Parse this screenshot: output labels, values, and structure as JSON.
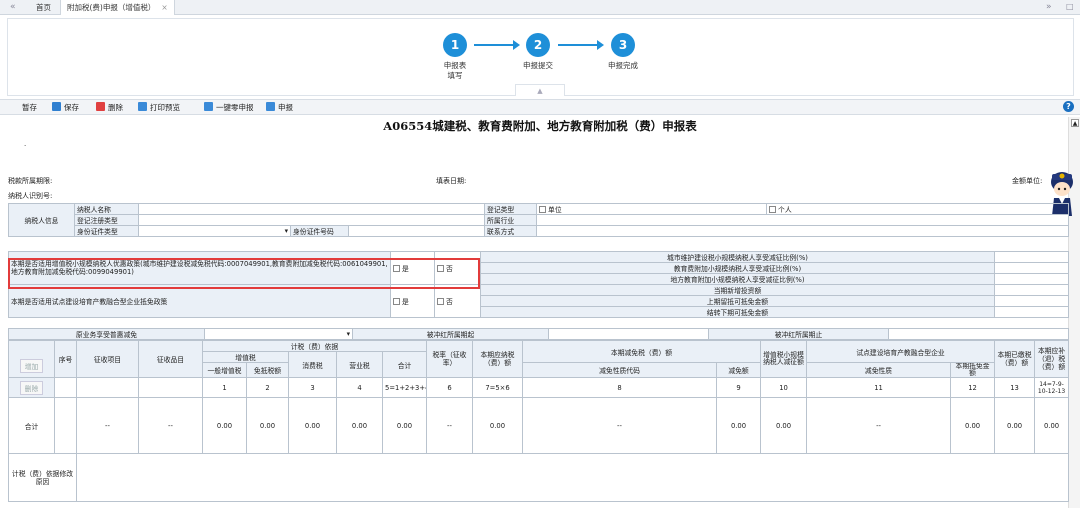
{
  "tabs": [
    {
      "label": "首页"
    },
    {
      "label": "附加税(费)申报（增值税）",
      "close": "×"
    }
  ],
  "steps": [
    {
      "num": "1",
      "label": "申报表填写"
    },
    {
      "num": "2",
      "label": "申报提交"
    },
    {
      "num": "3",
      "label": "申报完成"
    }
  ],
  "collapse_glyph": "▲",
  "toolbar": {
    "save_draft": "暂存",
    "save": "保存",
    "delete": "删除",
    "print_preview": "打印预览",
    "zero_declare": "一键零申报",
    "declare": "申报",
    "help": "?"
  },
  "form": {
    "title": "A06554城建税、教育费附加、地方教育附加税（费）申报表",
    "period_label": "税款所属期限:",
    "fill_date_label": "填表日期:",
    "amount_unit_label": "金额单位:",
    "taxpayer_id_label": "纳税人识别号:",
    "dot": "."
  },
  "info": {
    "section_label": "纳税人信息",
    "name_label": "纳税人名称",
    "reg_type_label": "登记注册类型",
    "id_type_label": "身份证件类型",
    "id_no_label": "身份证件号码",
    "reg_class_label": "登记类型",
    "unit_option": "单位",
    "person_option": "个人",
    "industry_label": "所属行业",
    "contact_label": "联系方式"
  },
  "policy": {
    "small_scale_q": "本期是否适用增值税小规模纳税人优惠政策(城市维护建设税减免税代码:0007049901,教育费附加减免税代码:0061049901,地方教育附加减免税代码:0099049901)",
    "yes": "是",
    "no": "否",
    "city_ratio": "城市维护建设税小规模纳税人享受减征比例(%)",
    "edu_ratio": "教育费附加小规模纳税人享受减征比例(%)",
    "local_edu_ratio": "地方教育附加小规模纳税人享受减征比例(%)",
    "pilot_q": "本期是否适用试点建设培育产教融合型企业抵免政策",
    "new_credit": "当期新增投资额",
    "prev_credit": "上期留抵可抵免金额",
    "carry_credit": "结转下期可抵免金额",
    "original_exemption": "原业务享受普惠减免",
    "offset_start": "被冲红所属期起",
    "offset_end": "被冲红所属期止"
  },
  "main_table": {
    "h_basis": "计税（费）依据",
    "h_vat": "增值税",
    "h_general": "一般增值税",
    "h_exempt_tax": "免抵税额",
    "h_consumption": "消费税",
    "h_business": "营业税",
    "h_total": "合计",
    "h_seq": "序号",
    "h_item": "征收项目",
    "h_subitem": "征收品目",
    "h_rate": "税率（征收率）",
    "h_payable": "本期应纳税（费）额",
    "h_reduction": "本期减免税（费）额",
    "h_reduction_code": "减免性质代码",
    "h_reduction_amt": "减免额",
    "h_small_reduce": "增值税小规模纳税人减征额",
    "h_pilot": "试点建设培育产教融合型企业",
    "h_pilot_nature": "减免性质",
    "h_pilot_credit": "本期抵免金额",
    "h_paid": "本期已缴税（费）额",
    "h_refund": "本期应补（退）税（费）额",
    "add_btn": "增加",
    "del_btn": "删除",
    "col_nums": [
      "1",
      "2",
      "3",
      "4",
      "5=1+2+3+4",
      "6",
      "7=5×6",
      "8",
      "9",
      "10",
      "11",
      "12",
      "13",
      "14=7-9-10-12-13"
    ],
    "total_label": "合计",
    "dash": "--",
    "zero": "0.00",
    "reason_label": "计税（费）依据修改原因"
  }
}
